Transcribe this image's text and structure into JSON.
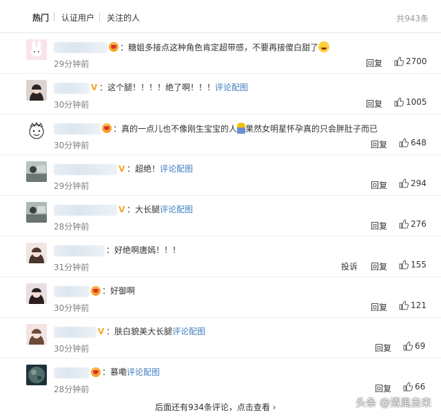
{
  "tabs": {
    "hot": "热门",
    "verified": "认证用户",
    "following": "关注的人",
    "total": "共943条"
  },
  "comments": [
    {
      "text": "糖姐多接点这种角色肯定超带感，不要再接傻白甜了",
      "emoji": "grin-sweat-emoji",
      "pic_link": "",
      "time": "29分钟前",
      "likes": "2700",
      "reply": "回复",
      "report": ""
    },
    {
      "text": "这个腿！！！！绝了啊！！！",
      "pic_link": "评论配图",
      "time": "30分钟前",
      "likes": "1005",
      "reply": "回复",
      "report": ""
    },
    {
      "text": "真的一点儿也不像刚生宝宝的人",
      "text2": "果然女明星怀孕真的只会胖肚子而已",
      "time": "30分钟前",
      "likes": "648",
      "reply": "回复",
      "report": ""
    },
    {
      "text": "超绝！",
      "pic_link": "评论配图",
      "time": "29分钟前",
      "likes": "294",
      "reply": "回复",
      "report": ""
    },
    {
      "text": "大长腿",
      "pic_link": "评论配图",
      "time": "28分钟前",
      "likes": "276",
      "reply": "回复",
      "report": ""
    },
    {
      "text": "好绝啊唐嫣！！！",
      "pic_link": "",
      "time": "31分钟前",
      "likes": "155",
      "reply": "回复",
      "report": "投诉"
    },
    {
      "text": "好御啊",
      "pic_link": "",
      "time": "30分钟前",
      "likes": "121",
      "reply": "回复",
      "report": ""
    },
    {
      "text": "肤白貌美大长腿",
      "pic_link": "评论配图",
      "time": "30分钟前",
      "likes": "69",
      "reply": "回复",
      "report": ""
    },
    {
      "text": "慕嘞",
      "pic_link": "评论配图",
      "time": "28分钟前",
      "likes": "66",
      "reply": "回复",
      "report": ""
    }
  ],
  "footer": {
    "more": "后面还有934条评论，点击查看 ›"
  },
  "watermark": "头条 @清風自来",
  "colors": {
    "link": "#3f7fc1",
    "vip": "#f5a623",
    "time": "#808080"
  }
}
